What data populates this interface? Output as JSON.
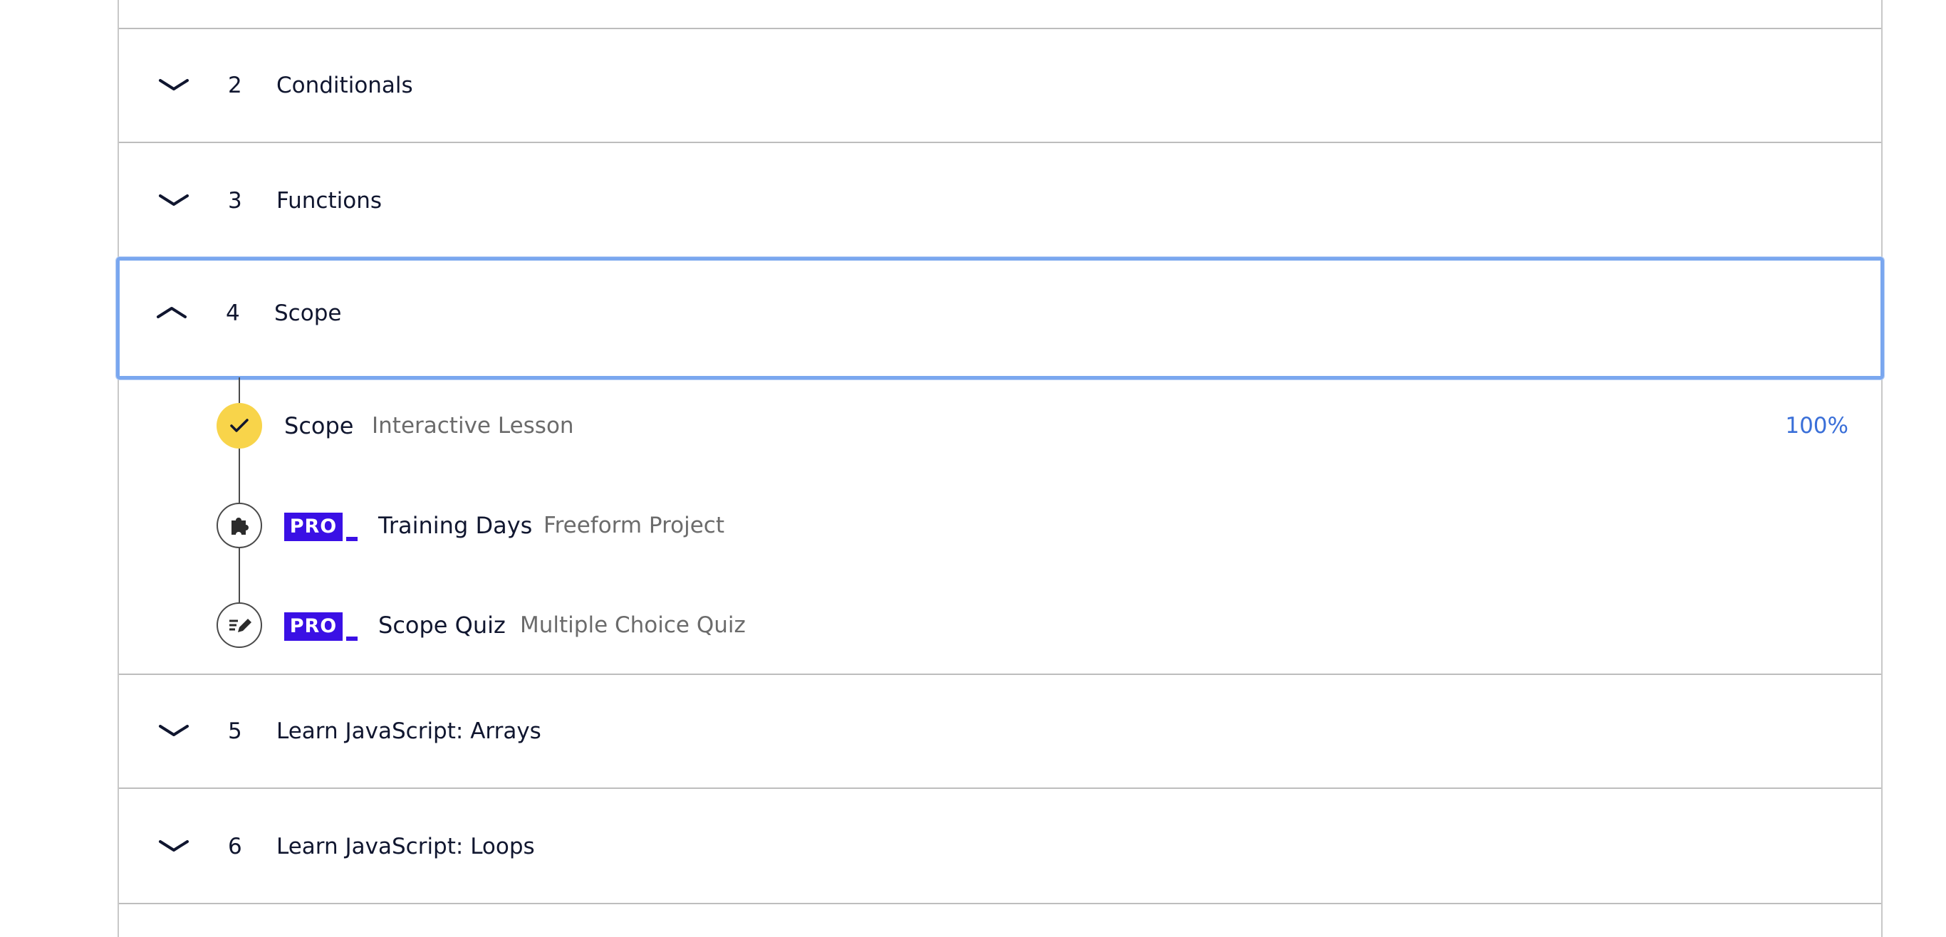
{
  "modules": [
    {
      "number": "2",
      "title": "Conditionals",
      "expanded": false
    },
    {
      "number": "3",
      "title": "Functions",
      "expanded": false
    },
    {
      "number": "4",
      "title": "Scope",
      "expanded": true
    },
    {
      "number": "5",
      "title": "Learn JavaScript: Arrays",
      "expanded": false
    },
    {
      "number": "6",
      "title": "Learn JavaScript: Loops",
      "expanded": false
    }
  ],
  "lessons": [
    {
      "name": "Scope",
      "type": "Interactive Lesson",
      "status": "complete",
      "progress": "100%",
      "pro": false,
      "icon": "check-icon"
    },
    {
      "name": "Training Days",
      "type": "Freeform Project",
      "status": "locked",
      "pro": true,
      "badge": "PRO",
      "icon": "puzzle-icon"
    },
    {
      "name": "Scope Quiz",
      "type": "Multiple Choice Quiz",
      "status": "locked",
      "pro": true,
      "badge": "PRO",
      "icon": "quiz-icon"
    }
  ],
  "colors": {
    "focus_ring": "#7aa7ef",
    "complete_node": "#f8d44a",
    "pro_badge": "#3a10e5",
    "progress_text": "#3a6fd8"
  }
}
